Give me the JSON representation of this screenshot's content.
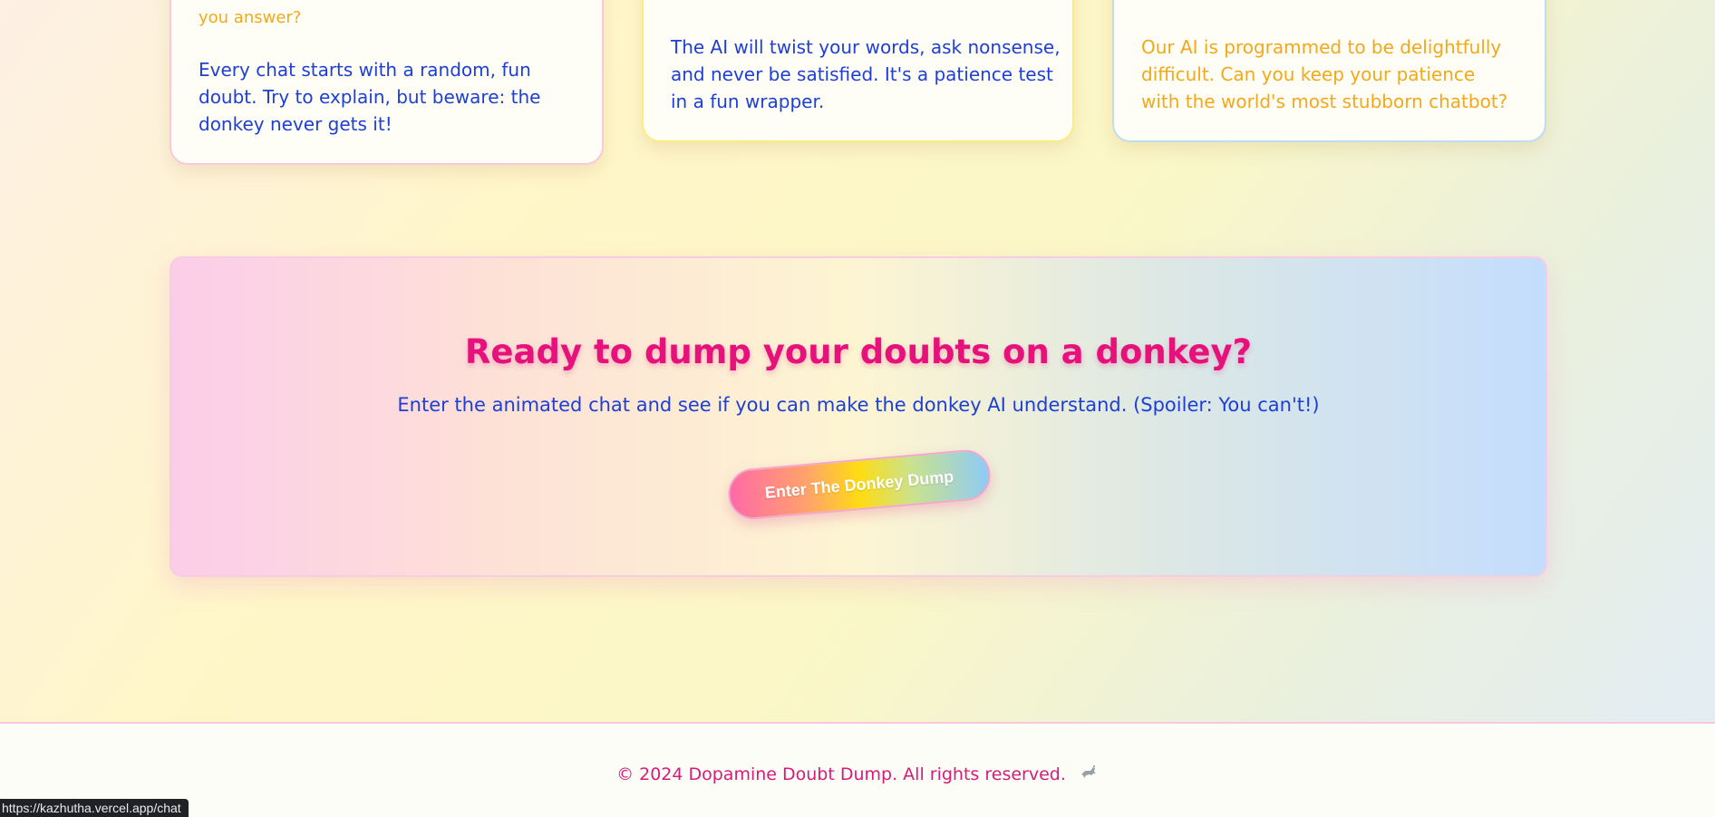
{
  "cards": [
    {
      "line_orange": "you answer?",
      "line_blue": "Every chat starts with a random, fun doubt. Try to explain, but beware: the donkey never gets it!"
    },
    {
      "line_blue": "The AI will twist your words, ask nonsense, and never be satisfied. It's a patience test in a fun wrapper."
    },
    {
      "line_orange": "Our AI is programmed to be delightfully difficult. Can you keep your patience with the world's most stubborn chatbot?"
    }
  ],
  "cta": {
    "title": "Ready to dump your doubts on a donkey?",
    "subtitle": "Enter the animated chat and see if you can make the donkey AI understand. (Spoiler: You can't!)",
    "button_label": "Enter The Donkey Dump"
  },
  "footer": {
    "copyright": "© 2024 Dopamine Doubt Dump. All rights reserved.",
    "icon": "donkey-icon"
  },
  "status_bar": {
    "url": "https://kazhutha.vercel.app/chat"
  },
  "colors": {
    "title_pink": "#e6117a",
    "text_blue": "#1e3fd6",
    "text_orange": "#f2a81b",
    "footer_pink": "#d81b7a"
  }
}
